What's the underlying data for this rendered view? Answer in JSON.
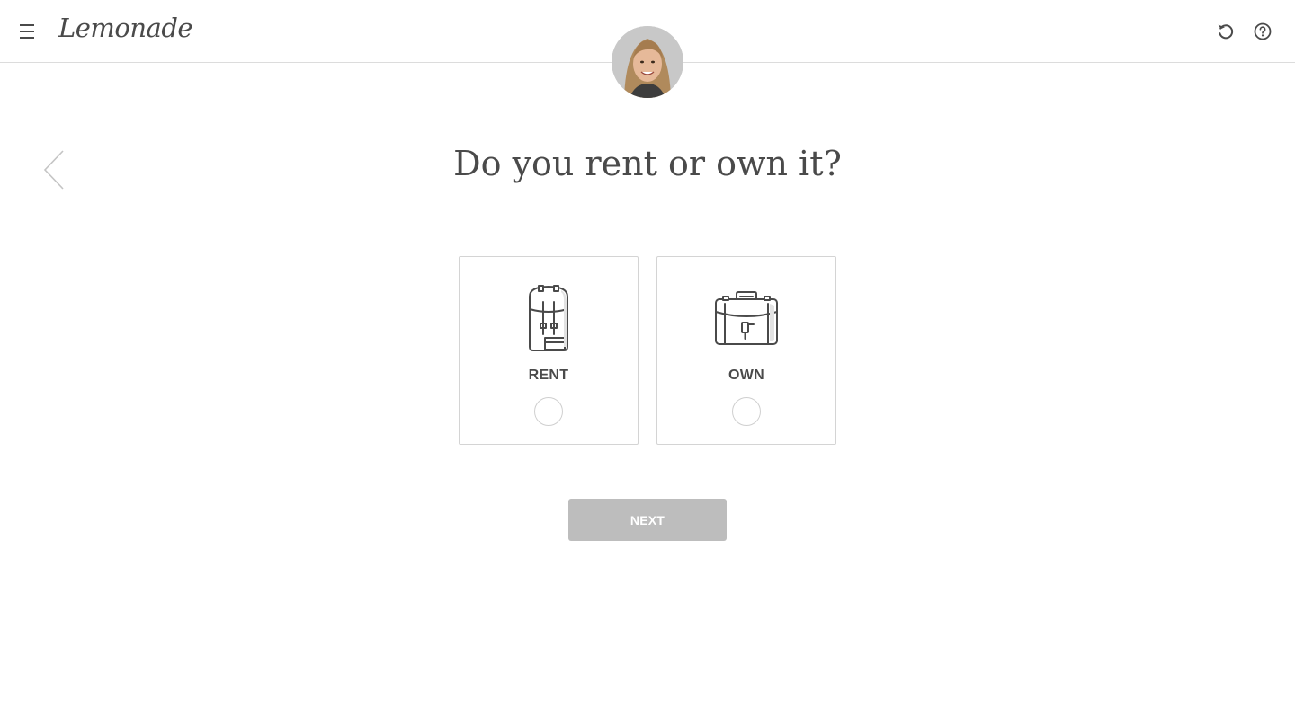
{
  "header": {
    "logo_text": "Lemonade",
    "menu_icon": "hamburger-menu-icon",
    "restart_icon": "restart-icon",
    "help_icon": "help-icon"
  },
  "assistant": {
    "avatar_icon": "assistant-avatar"
  },
  "navigation": {
    "back_icon": "chevron-left-icon"
  },
  "question": {
    "title": "Do you rent or own it?"
  },
  "options": [
    {
      "label": "RENT",
      "icon": "backpack-icon",
      "selected": false
    },
    {
      "label": "OWN",
      "icon": "briefcase-icon",
      "selected": false
    }
  ],
  "next_button": {
    "label": "NEXT",
    "enabled": false
  },
  "colors": {
    "text": "#4a4a4a",
    "border": "#d4d4d4",
    "button_disabled": "#bdbdbd",
    "header_divider": "#dcdcdc"
  }
}
